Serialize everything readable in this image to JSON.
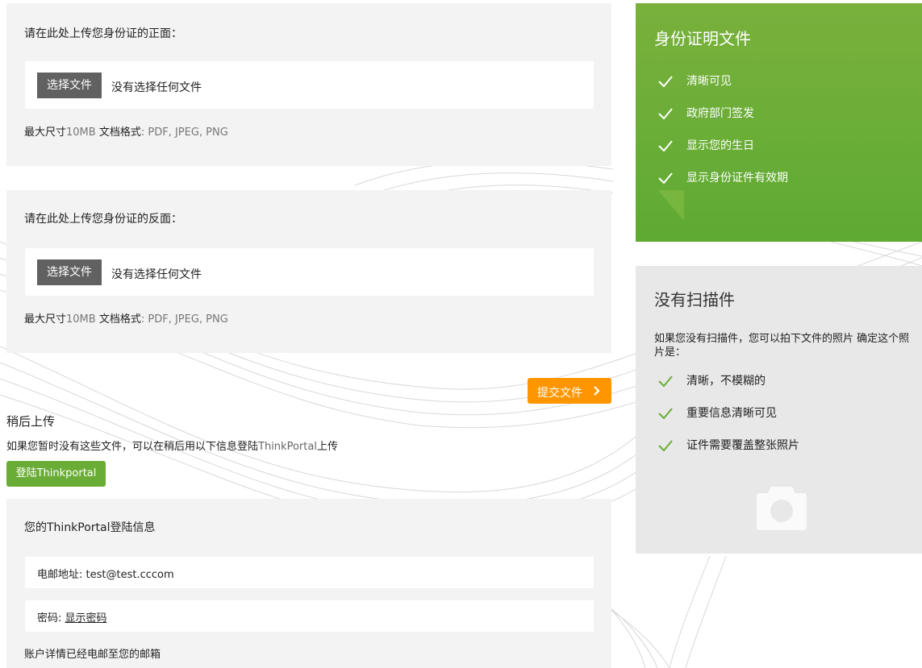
{
  "upload_front": {
    "title": "请在此处上传您身份证的正面：",
    "button_label": "选择文件",
    "status": "没有选择任何文件",
    "hint_prefix": "最大尺寸",
    "hint_size": "10MB",
    "hint_mid": " 文档格式",
    "hint_formats": ": PDF, JPEG, PNG"
  },
  "upload_back": {
    "title": "请在此处上传您身份证的反面：",
    "button_label": "选择文件",
    "status": "没有选择任何文件",
    "hint_prefix": "最大尺寸",
    "hint_size": "10MB",
    "hint_mid": " 文档格式",
    "hint_formats": ": PDF, JPEG, PNG"
  },
  "submit": {
    "label": "提交文件"
  },
  "later": {
    "title": "稍后上传",
    "desc_prefix": "如果您暂时没有这些文件，可以在稍后用以下信息登陆",
    "desc_brand": "ThinkPortal",
    "desc_suffix": "上传",
    "login_button": "登陆Thinkportal"
  },
  "login_info": {
    "title": "您的ThinkPortal登陆信息",
    "email_label": "电邮地址",
    "email_value": ": test@test.cccom",
    "password_label": "密码",
    "password_sep": ": ",
    "password_link": "显示密码",
    "footer": "账户详情已经电邮至您的邮箱"
  },
  "id_requirements": {
    "title": "身份证明文件",
    "items": [
      "清晰可见",
      "政府部门签发",
      "显示您的生日",
      "显示身份证件有效期"
    ]
  },
  "no_scanner": {
    "title": "没有扫描件",
    "desc": "如果您没有扫描件，您可以拍下文件的照片 确定这个照片是：",
    "items": [
      "清晰，不模糊的",
      "重要信息清晰可见",
      "证件需要覆盖整张照片"
    ],
    "icon": "camera-icon"
  },
  "colors": {
    "accent_orange": "#ff9600",
    "accent_green": "#6aad36",
    "card_green": "#69ad37",
    "panel_gray": "#f3f3f3",
    "file_button": "#616161"
  }
}
